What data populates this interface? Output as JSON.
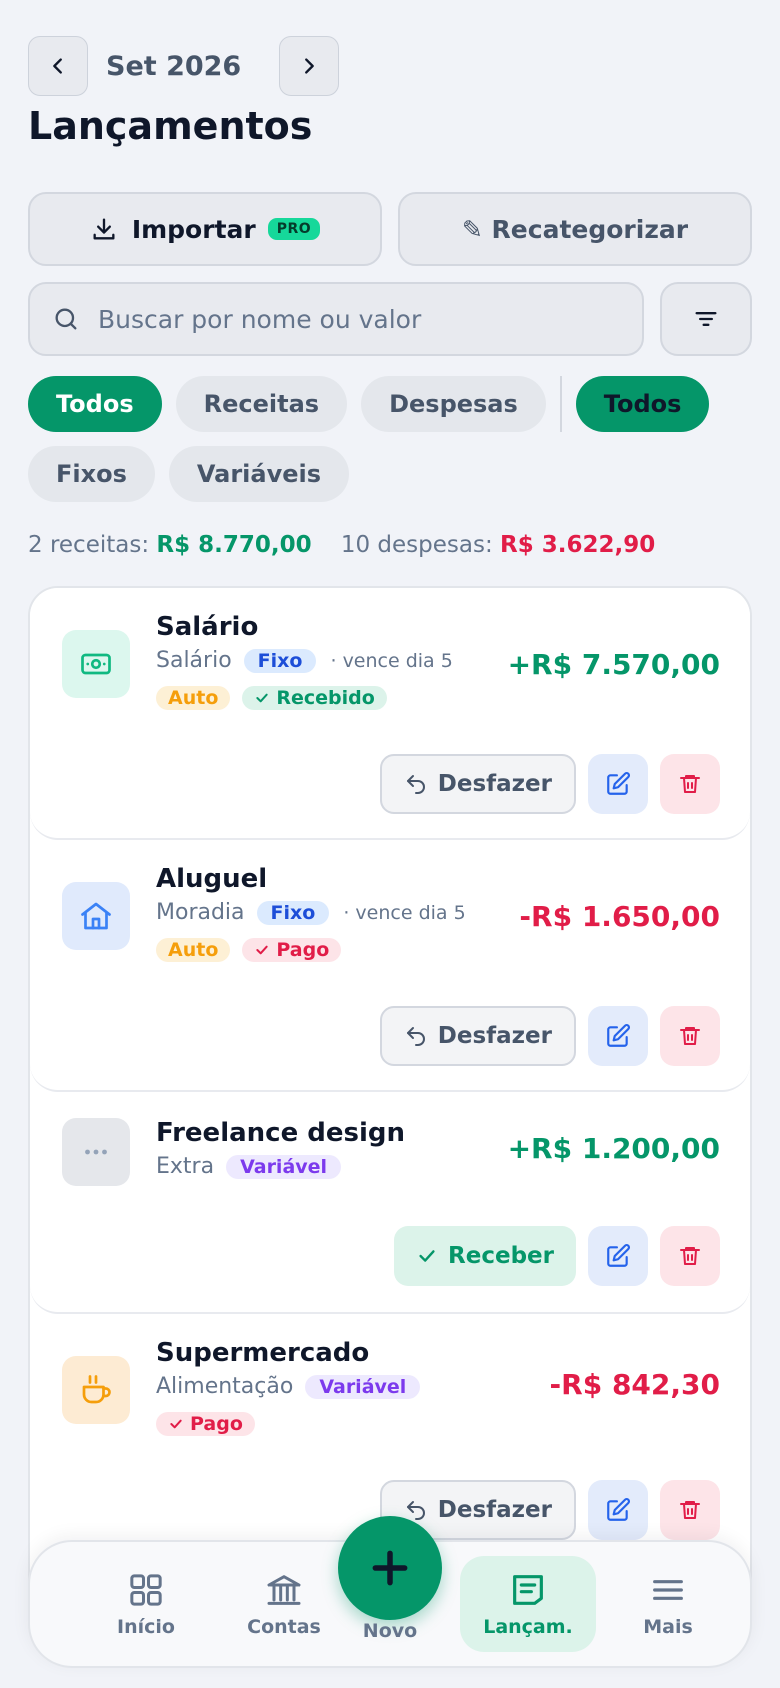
{
  "header": {
    "month": "Set 2026",
    "title": "Lançamentos"
  },
  "actions": {
    "import_label": "Importar",
    "pro_badge": "PRO",
    "recat_label": "✎ Recategorizar"
  },
  "search": {
    "placeholder": "Buscar por nome ou valor",
    "value": ""
  },
  "filters": {
    "type_chips": [
      "Todos",
      "Receitas",
      "Despesas"
    ],
    "recurrence_chips": [
      "Todos",
      "Fixos",
      "Variáveis"
    ]
  },
  "summary": {
    "income_label": "2 receitas:",
    "income_value": "R$ 8.770,00",
    "expense_label": "10 despesas:",
    "expense_value": "R$ 3.622,90"
  },
  "transactions": [
    {
      "name": "Salário",
      "category": "Salário",
      "kind": "Fixo",
      "due": "· vence dia 5",
      "badge_auto": "Auto",
      "badge_status": "Recebido",
      "amount": "+R$ 7.570,00",
      "action": "Desfazer"
    },
    {
      "name": "Aluguel",
      "category": "Moradia",
      "kind": "Fixo",
      "due": "· vence dia 5",
      "badge_auto": "Auto",
      "badge_status": "Pago",
      "amount": "-R$ 1.650,00",
      "action": "Desfazer"
    },
    {
      "name": "Freelance design",
      "category": "Extra",
      "kind": "Variável",
      "amount": "+R$ 1.200,00",
      "action": "Receber"
    },
    {
      "name": "Supermercado",
      "category": "Alimentação",
      "kind": "Variável",
      "badge_status": "Pago",
      "amount": "-R$ 842,30",
      "action": "Desfazer"
    }
  ],
  "icons": [
    "cash-icon",
    "home-icon",
    "more-dots-icon",
    "coffee-icon"
  ],
  "bottom_nav": {
    "home": "Início",
    "accounts": "Contas",
    "new": "Novo",
    "entries": "Lançam.",
    "more": "Mais"
  },
  "colors": {
    "primary": "#059669",
    "income": "#059669",
    "expense": "#e11d48",
    "fixed": "#1d4ed8",
    "variable": "#7c3aed",
    "auto": "#f59e0b"
  }
}
